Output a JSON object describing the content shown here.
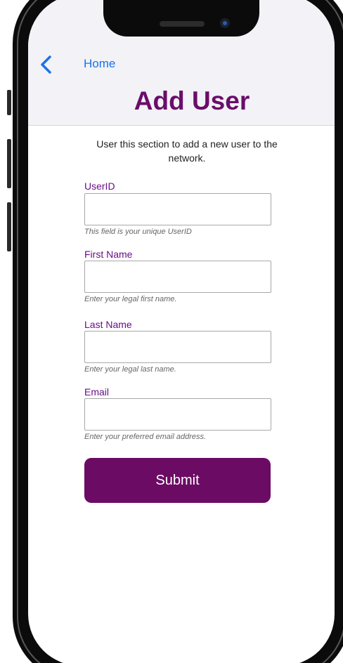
{
  "header": {
    "back_link": "Home",
    "title": "Add User"
  },
  "intro": "User this section to add a new user to the network.",
  "form": {
    "fields": [
      {
        "label": "UserID",
        "value": "",
        "hint": "This field is your unique UserID"
      },
      {
        "label": "First Name",
        "value": "",
        "hint": "Enter your legal first name."
      },
      {
        "label": "Last Name",
        "value": "",
        "hint": "Enter your legal last name."
      },
      {
        "label": "Email",
        "value": "",
        "hint": "Enter your preferred email address."
      }
    ],
    "submit_label": "Submit"
  },
  "colors": {
    "accent": "#6b0b63",
    "title": "#6a0d6a",
    "link": "#1a73e8",
    "header_bg": "#f2f2f7"
  },
  "icons": {
    "back": "chevron-left-icon"
  }
}
